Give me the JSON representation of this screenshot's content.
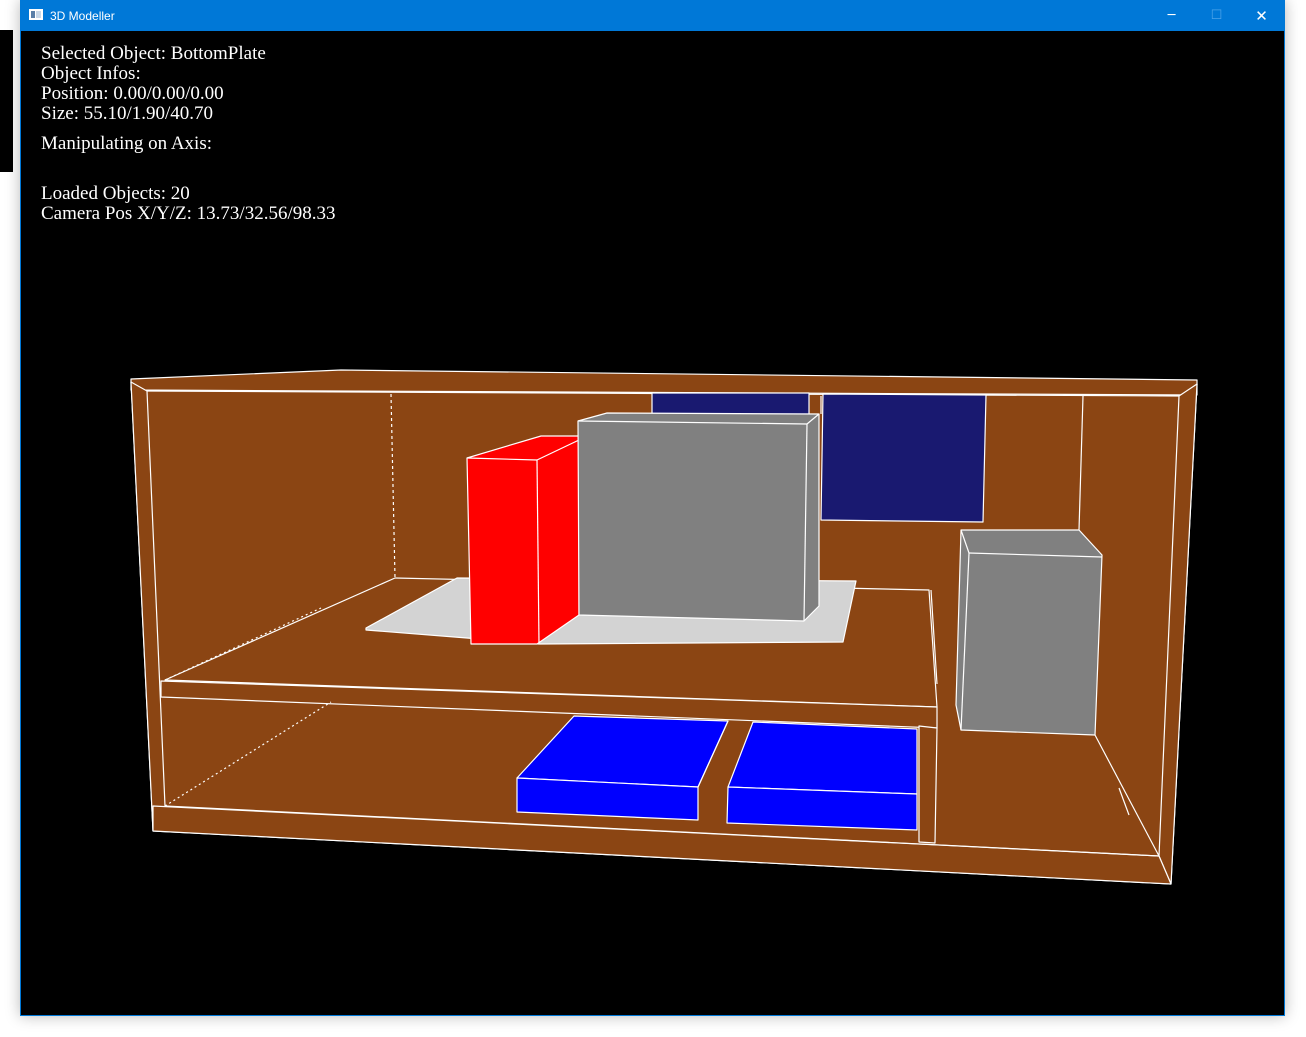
{
  "window": {
    "title": "3D Modeller",
    "minimize_glyph": "─",
    "maximize_glyph": "☐",
    "close_glyph": "✕"
  },
  "hud": {
    "selected_object": "Selected Object: BottomPlate",
    "object_infos": "Object Infos:",
    "position": "Position: 0.00/0.00/0.00",
    "size": "Size: 55.10/1.90/40.70",
    "manipulating_axis": "Manipulating on Axis:",
    "loaded_objects": "Loaded Objects: 20",
    "camera_pos": "Camera Pos X/Y/Z: 13.73/32.56/98.33"
  },
  "colors": {
    "background": "#000000",
    "wood": "#8b4513",
    "edge": "#ffffff",
    "red_box": "#ff0000",
    "gray_box": "#808080",
    "navy_box": "#191970",
    "blue_box": "#0000ff",
    "plate": "#d3d3d3",
    "titlebar": "#0078d7"
  }
}
